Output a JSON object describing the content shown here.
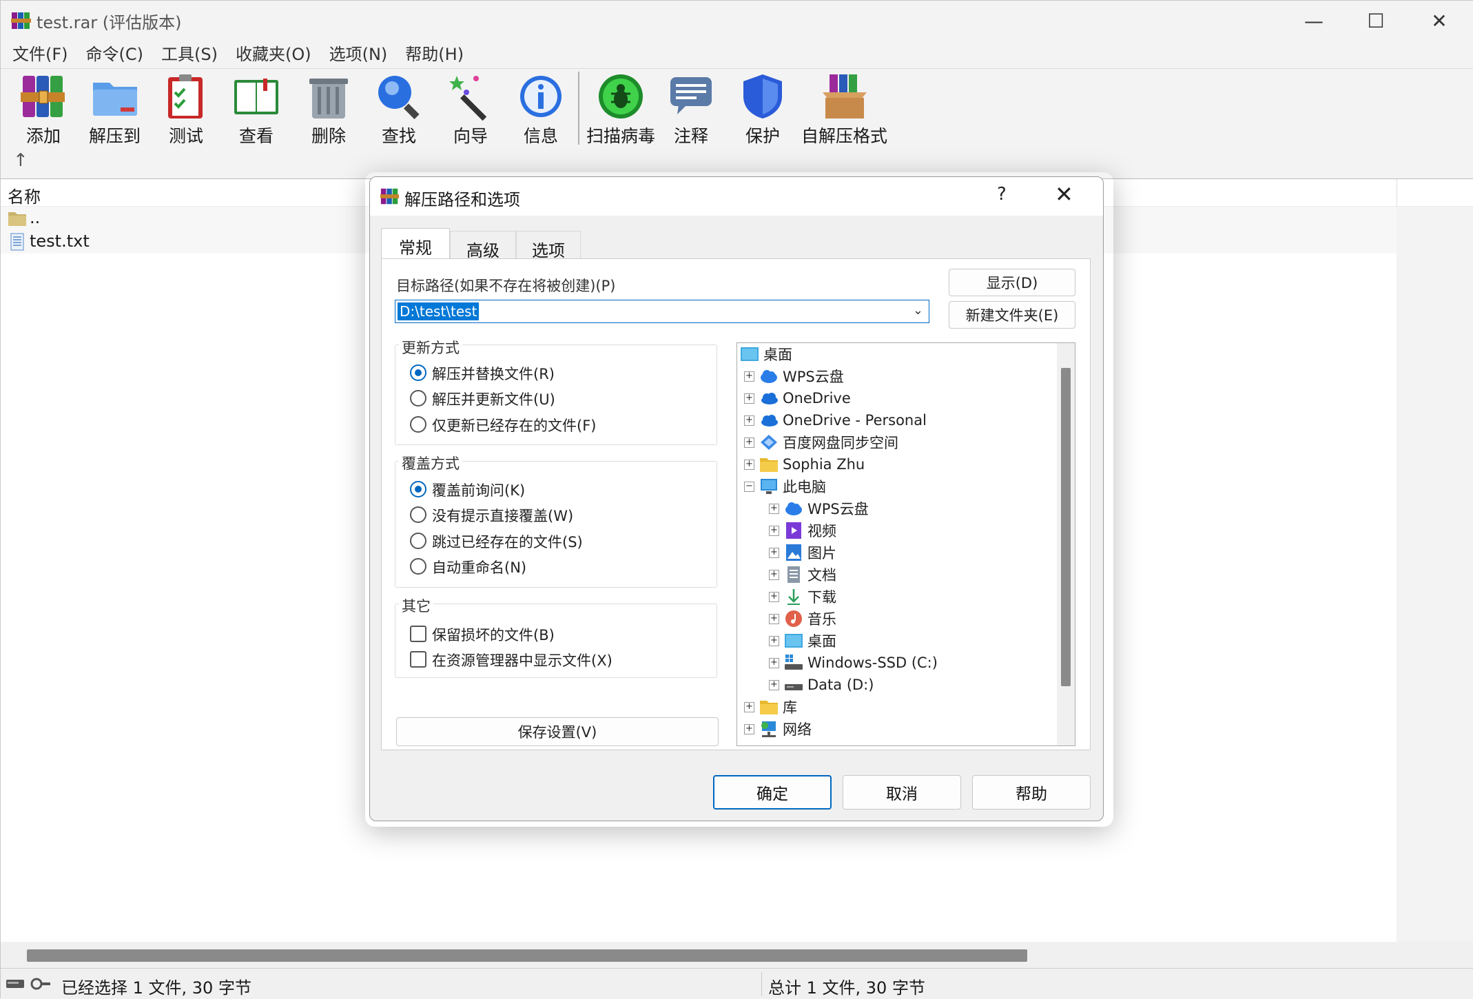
{
  "window": {
    "title": "test.rar (评估版本)",
    "controls": {
      "minimize": "—",
      "maximize": "☐",
      "close": "✕"
    }
  },
  "menu": [
    "文件(F)",
    "命令(C)",
    "工具(S)",
    "收藏夹(O)",
    "选项(N)",
    "帮助(H)"
  ],
  "toolbar": {
    "buttons": [
      {
        "label": "添加",
        "icon": "add-archive-icon"
      },
      {
        "label": "解压到",
        "icon": "extract-folder-icon"
      },
      {
        "label": "测试",
        "icon": "test-clipboard-icon"
      },
      {
        "label": "查看",
        "icon": "view-book-icon"
      },
      {
        "label": "删除",
        "icon": "trash-icon"
      },
      {
        "label": "查找",
        "icon": "magnifier-icon"
      },
      {
        "label": "向导",
        "icon": "wizard-wand-icon"
      },
      {
        "label": "信息",
        "icon": "info-icon"
      },
      {
        "label": "扫描病毒",
        "icon": "virus-scan-icon"
      },
      {
        "label": "注释",
        "icon": "comment-icon"
      },
      {
        "label": "保护",
        "icon": "shield-icon"
      },
      {
        "label": "自解压格式",
        "icon": "sfx-box-icon"
      }
    ],
    "up": "↑"
  },
  "filelist": {
    "column_name": "名称",
    "rows": [
      {
        "name": "..",
        "icon": "parent-folder-icon"
      },
      {
        "name": "test.txt",
        "icon": "text-file-icon"
      }
    ]
  },
  "status": {
    "left": "已经选择 1 文件, 30 字节",
    "right": "总计 1 文件, 30 字节"
  },
  "dialog": {
    "title": "解压路径和选项",
    "help": "?",
    "close": "✕",
    "tabs": [
      "常规",
      "高级",
      "选项"
    ],
    "active_tab": "常规",
    "path_label": "目标路径(如果不存在将被创建)(P)",
    "path_value": "D:\\test\\test",
    "show_button": "显示(D)",
    "new_folder_button": "新建文件夹(E)",
    "update_group": {
      "title": "更新方式",
      "options": [
        "解压并替换文件(R)",
        "解压并更新文件(U)",
        "仅更新已经存在的文件(F)"
      ],
      "selected": 0
    },
    "overwrite_group": {
      "title": "覆盖方式",
      "options": [
        "覆盖前询问(K)",
        "没有提示直接覆盖(W)",
        "跳过已经存在的文件(S)",
        "自动重命名(N)"
      ],
      "selected": 0
    },
    "other_group": {
      "title": "其它",
      "options": [
        "保留损坏的文件(B)",
        "在资源管理器中显示文件(X)"
      ]
    },
    "save_settings": "保存设置(V)",
    "tree": [
      {
        "label": "桌面",
        "icon": "desktop-icon",
        "level": 0,
        "expander": ""
      },
      {
        "label": "WPS云盘",
        "icon": "cloud-icon",
        "level": 1,
        "expander": "+"
      },
      {
        "label": "OneDrive",
        "icon": "onedrive-icon",
        "level": 1,
        "expander": "+"
      },
      {
        "label": "OneDrive - Personal",
        "icon": "onedrive-icon",
        "level": 1,
        "expander": "+"
      },
      {
        "label": "百度网盘同步空间",
        "icon": "baidu-icon",
        "level": 1,
        "expander": "+"
      },
      {
        "label": "Sophia Zhu",
        "icon": "folder-icon",
        "level": 1,
        "expander": "+"
      },
      {
        "label": "此电脑",
        "icon": "computer-icon",
        "level": 1,
        "expander": "−"
      },
      {
        "label": "WPS云盘",
        "icon": "cloud-icon",
        "level": 2,
        "expander": "+"
      },
      {
        "label": "视频",
        "icon": "video-icon",
        "level": 2,
        "expander": "+"
      },
      {
        "label": "图片",
        "icon": "picture-icon",
        "level": 2,
        "expander": "+"
      },
      {
        "label": "文档",
        "icon": "document-icon",
        "level": 2,
        "expander": "+"
      },
      {
        "label": "下载",
        "icon": "download-icon",
        "level": 2,
        "expander": "+"
      },
      {
        "label": "音乐",
        "icon": "music-icon",
        "level": 2,
        "expander": "+"
      },
      {
        "label": "桌面",
        "icon": "desktop-icon",
        "level": 2,
        "expander": "+"
      },
      {
        "label": "Windows-SSD (C:)",
        "icon": "drive-c-icon",
        "level": 2,
        "expander": "+"
      },
      {
        "label": "Data (D:)",
        "icon": "drive-icon",
        "level": 2,
        "expander": "+"
      },
      {
        "label": "库",
        "icon": "library-folder-icon",
        "level": 1,
        "expander": "+"
      },
      {
        "label": "网络",
        "icon": "network-icon",
        "level": 1,
        "expander": "+"
      }
    ],
    "ok": "确定",
    "cancel": "取消",
    "help_button": "帮助"
  },
  "colors": {
    "accent": "#0067c0",
    "selection": "#0078d7"
  }
}
